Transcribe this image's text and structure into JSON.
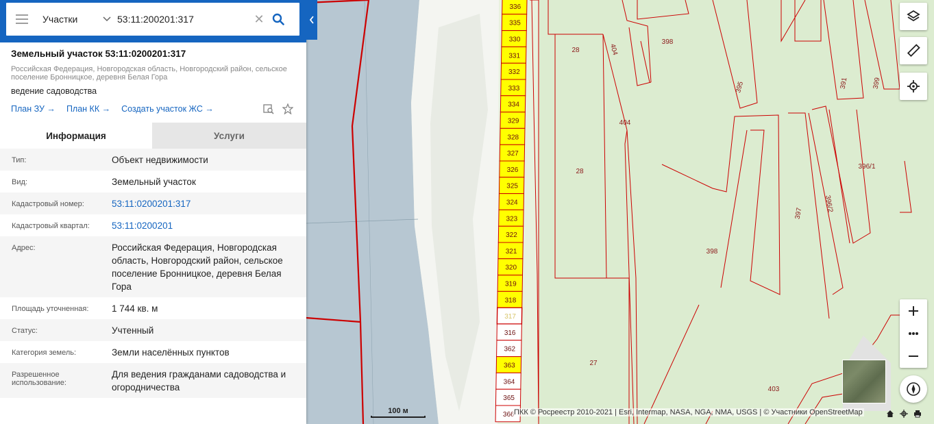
{
  "search": {
    "type_label": "Участки",
    "query": "53:11:200201:317"
  },
  "object": {
    "title": "Земельный участок 53:11:0200201:317",
    "address_short": "Российская Федерация, Новгородская область, Новгородский район, сельское поселение Бронницкое, деревня Белая Гора",
    "purpose": "ведение садоводства",
    "links": [
      "План ЗУ →",
      "План КК →",
      "Создать участок ЖС →"
    ]
  },
  "tabs": {
    "info": "Информация",
    "services": "Услуги"
  },
  "info": [
    {
      "key": "Тип:",
      "value": "Объект недвижимости"
    },
    {
      "key": "Вид:",
      "value": "Земельный участок"
    },
    {
      "key": "Кадастровый номер:",
      "value": "53:11:0200201:317",
      "link": true
    },
    {
      "key": "Кадастровый квартал:",
      "value": "53:11:0200201",
      "link": true
    },
    {
      "key": "Адрес:",
      "value": "Российская Федерация, Новгородская область, Новгородский район, сельское поселение Бронницкое, деревня Белая Гора"
    },
    {
      "key": "Площадь уточненная:",
      "value": "1 744 кв. м"
    },
    {
      "key": "Статус:",
      "value": "Учтенный"
    },
    {
      "key": "Категория земель:",
      "value": "Земли населённых пунктов"
    },
    {
      "key": "Разрешенное использование:",
      "value": "Для ведения гражданами садоводства и огородничества"
    }
  ],
  "map": {
    "strip_parcels": [
      "336",
      "335",
      "330",
      "331",
      "332",
      "333",
      "334",
      "329",
      "328",
      "327",
      "326",
      "325",
      "324",
      "323",
      "322",
      "321",
      "320",
      "319",
      "318",
      "317",
      "316",
      "362",
      "363",
      "364",
      "365",
      "366"
    ],
    "highlighted_parcels": [
      "336",
      "335",
      "330",
      "331",
      "332",
      "333",
      "334",
      "329",
      "328",
      "327",
      "326",
      "325",
      "324",
      "323",
      "322",
      "321",
      "320",
      "319",
      "318",
      "363"
    ],
    "selected_parcel": "317",
    "labels": [
      "28",
      "404",
      "398",
      "395",
      "391",
      "399",
      "404",
      "28",
      "396/1",
      "396/2",
      "397",
      "398",
      "27",
      "403"
    ],
    "scale_label": "100 м",
    "attribution": "ПКК © Росреестр 2010-2021 | Esri, Intermap, NASA, NGA, NMA, USGS | © Участники OpenStreetMap"
  },
  "colors": {
    "brand": "#1565c0",
    "parcel_border": "#cc0000",
    "parcel_fill": "#ffff00",
    "selected_fill": "#ffffff",
    "land": "#e7f0dd",
    "water": "#b7c7d2"
  }
}
